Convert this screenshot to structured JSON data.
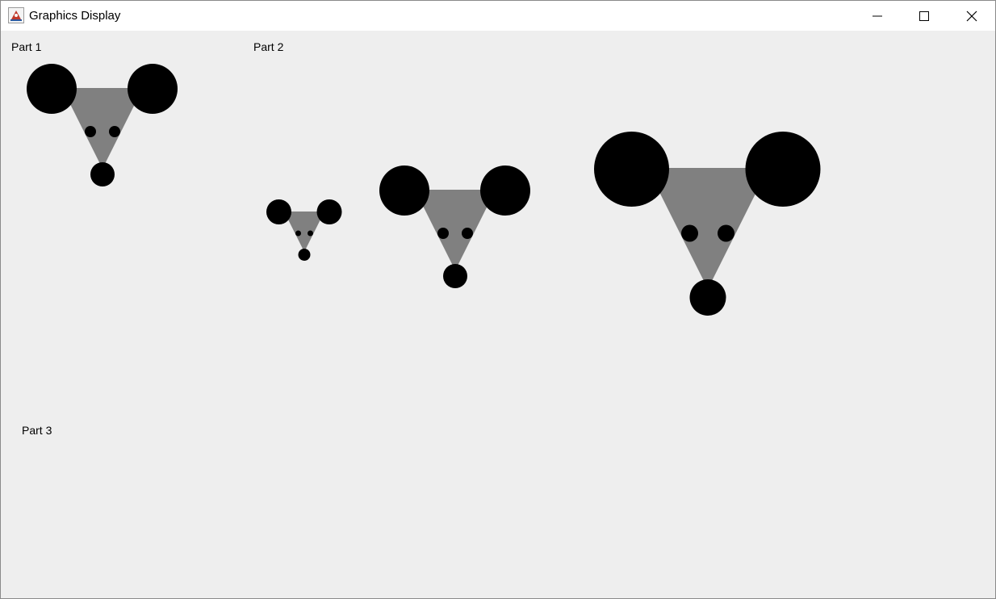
{
  "window": {
    "title": "Graphics Display",
    "app_icon": "java-cup-icon",
    "controls": {
      "minimize_icon": "minimize-icon",
      "maximize_icon": "maximize-icon",
      "close_icon": "close-icon"
    }
  },
  "canvas": {
    "background": "#eeeeee",
    "labels": {
      "part1": "Part 1",
      "part2": "Part 2",
      "part3": "Part 3"
    },
    "colors": {
      "face": "#808080",
      "features": "#000000"
    }
  }
}
